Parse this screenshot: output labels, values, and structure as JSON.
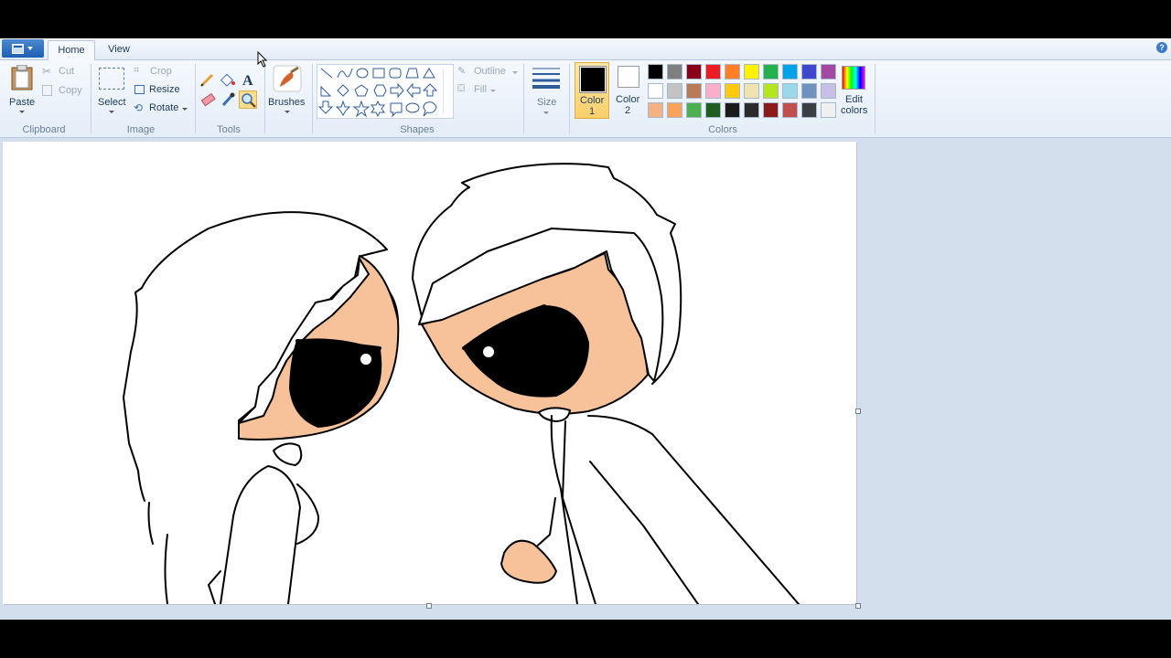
{
  "tabs": {
    "home": "Home",
    "view": "View"
  },
  "clipboard": {
    "paste": "Paste",
    "cut": "Cut",
    "copy": "Copy",
    "group": "Clipboard"
  },
  "image": {
    "select": "Select",
    "crop": "Crop",
    "resize": "Resize",
    "rotate": "Rotate",
    "group": "Image"
  },
  "tools": {
    "group": "Tools"
  },
  "brushes": {
    "label": "Brushes"
  },
  "shapes": {
    "outline": "Outline",
    "fill": "Fill",
    "group": "Shapes"
  },
  "size": {
    "label": "Size"
  },
  "colors": {
    "color1_label": "Color",
    "color1_num": "1",
    "color2_label": "Color",
    "color2_num": "2",
    "edit_line1": "Edit",
    "edit_line2": "colors",
    "group": "Colors",
    "palette_row1": [
      "#000000",
      "#7f7f7f",
      "#880015",
      "#ed1c24",
      "#ff7f27",
      "#fff200",
      "#22b14c",
      "#00a2e8",
      "#3f48cc",
      "#a349a4"
    ],
    "palette_row2": [
      "#ffffff",
      "#c3c3c3",
      "#b97a57",
      "#ffaec9",
      "#ffc90e",
      "#efe4b0",
      "#b5e61d",
      "#99d9ea",
      "#7092be",
      "#c8bfe7"
    ],
    "palette_row3": [
      "#f4b183",
      "#f7a35c",
      "#4caf50",
      "#1e5e20",
      "#1b1b1b",
      "#2b2b2b",
      "#8b1a1a",
      "#c0504d",
      "#3a3f44",
      "#f0f0f0"
    ]
  },
  "skin_color": "#f7c19a"
}
